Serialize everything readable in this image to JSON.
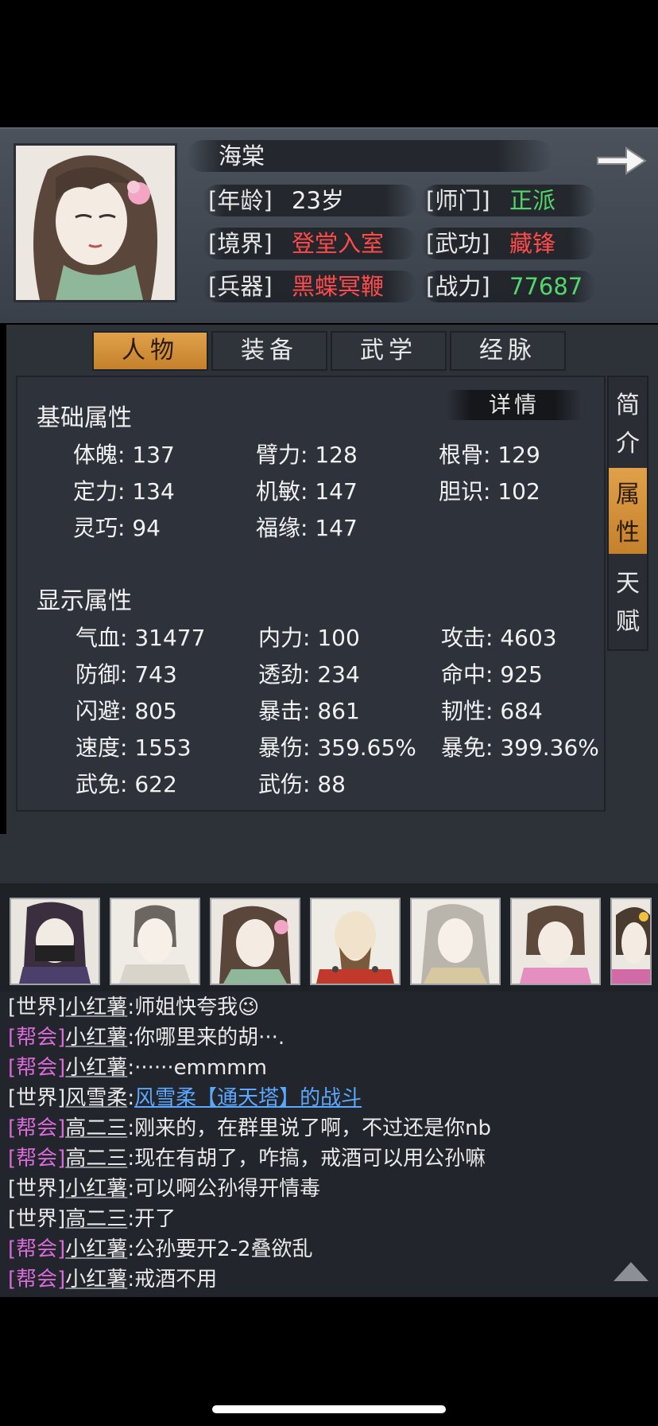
{
  "character": {
    "name": "海棠",
    "age_label": "[年龄]",
    "age_value": "23岁",
    "sect_label": "[师门]",
    "sect_value": "正派",
    "realm_label": "[境界]",
    "realm_value": "登堂入室",
    "skill_label": "[武功]",
    "skill_value": "藏锋",
    "weapon_label": "[兵器]",
    "weapon_value": "黑蝶冥鞭",
    "power_label": "[战力]",
    "power_value": "77687"
  },
  "tabs": [
    "人物",
    "装备",
    "武学",
    "经脉"
  ],
  "active_tab": "人物",
  "side_tabs": [
    {
      "chars": [
        "简",
        "介"
      ],
      "active": false
    },
    {
      "chars": [
        "属",
        "性"
      ],
      "active": true
    },
    {
      "chars": [
        "天",
        "赋"
      ],
      "active": false
    }
  ],
  "detail_button": "详情",
  "base_attributes": {
    "title": "基础属性",
    "items": [
      "体魄: 137",
      "臂力: 128",
      "根骨: 129",
      "定力: 134",
      "机敏: 147",
      "胆识: 102",
      "灵巧: 94",
      "福缘: 147"
    ]
  },
  "display_attributes": {
    "title": "显示属性",
    "items": [
      "气血: 31477",
      "内力: 100",
      "攻击: 4603",
      "防御: 743",
      "透劲: 234",
      "命中: 925",
      "闪避: 805",
      "暴击: 861",
      "韧性: 684",
      "速度: 1553",
      "暴伤: 359.65%",
      "暴免: 399.36%",
      "武免: 622",
      "武伤: 88"
    ]
  },
  "chat": [
    {
      "channel": "[世界]",
      "channel_type": "world",
      "name": "小红薯",
      "message": ":师姐快夸我😉"
    },
    {
      "channel": "[帮会]",
      "channel_type": "guild",
      "name": "小红薯",
      "message": ":你哪里来的胡···."
    },
    {
      "channel": "[帮会]",
      "channel_type": "guild",
      "name": "小红薯",
      "message": ":······emmmm"
    },
    {
      "channel": "[世界]",
      "channel_type": "world",
      "name": "风雪柔",
      "message": ":",
      "link": "风雪柔【通天塔】的战斗"
    },
    {
      "channel": "[帮会]",
      "channel_type": "guild",
      "name": "高二三",
      "message": ":刚来的，在群里说了啊，不过还是你nb"
    },
    {
      "channel": "[帮会]",
      "channel_type": "guild",
      "name": "高二三",
      "message": ":现在有胡了，咋搞，戒酒可以用公孙嘛"
    },
    {
      "channel": "[世界]",
      "channel_type": "world",
      "name": "小红薯",
      "message": ":可以啊公孙得开情毒"
    },
    {
      "channel": "[世界]",
      "channel_type": "world",
      "name": "高二三",
      "message": ":开了"
    },
    {
      "channel": "[帮会]",
      "channel_type": "guild",
      "name": "小红薯",
      "message": ":公孙要开2-2叠欲乱"
    },
    {
      "channel": "[帮会]",
      "channel_type": "guild",
      "name": "小红薯",
      "message": ":戒酒不用"
    }
  ]
}
